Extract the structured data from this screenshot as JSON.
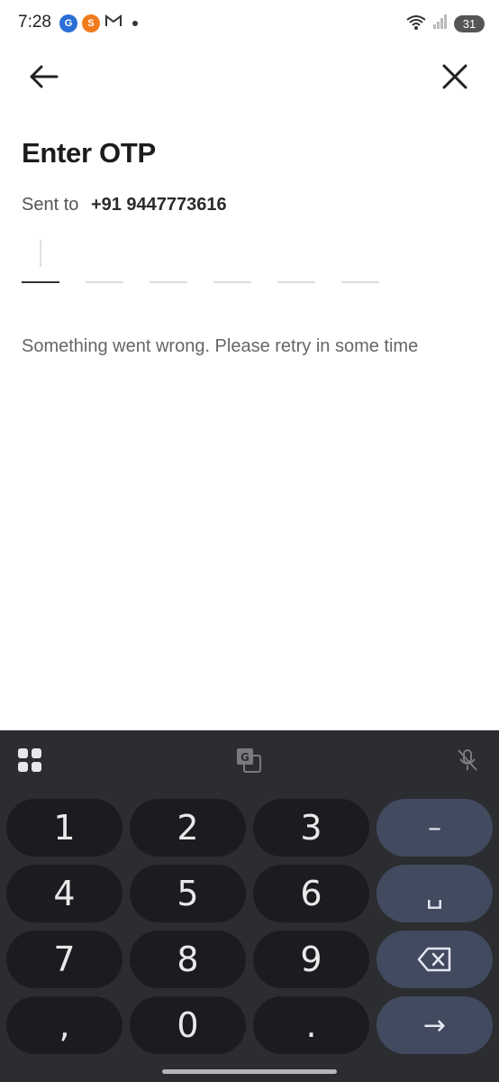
{
  "status_bar": {
    "time": "7:28",
    "battery": "31",
    "wifi_label": "5"
  },
  "header": {
    "back_icon": "arrow-left-icon",
    "close_icon": "close-icon"
  },
  "title": "Enter OTP",
  "sent_to_label": "Sent to",
  "phone_number": "+91 9447773616",
  "otp_digits": [
    "",
    "",
    "",
    "",
    "",
    ""
  ],
  "error_message": "Something went wrong. Please retry in some time",
  "keyboard": {
    "rows": [
      [
        "1",
        "2",
        "3",
        "–"
      ],
      [
        "4",
        "5",
        "6",
        "␣"
      ],
      [
        "7",
        "8",
        "9",
        "⌫"
      ],
      [
        ",",
        "0",
        ".",
        "→"
      ]
    ],
    "toolbar_icons": [
      "grid-icon",
      "translate-icon",
      "mic-off-icon"
    ]
  },
  "colors": {
    "keyboard_bg": "#2c2d31",
    "key_bg": "#1b1c1f",
    "func_key_bg": "#414a5e"
  }
}
